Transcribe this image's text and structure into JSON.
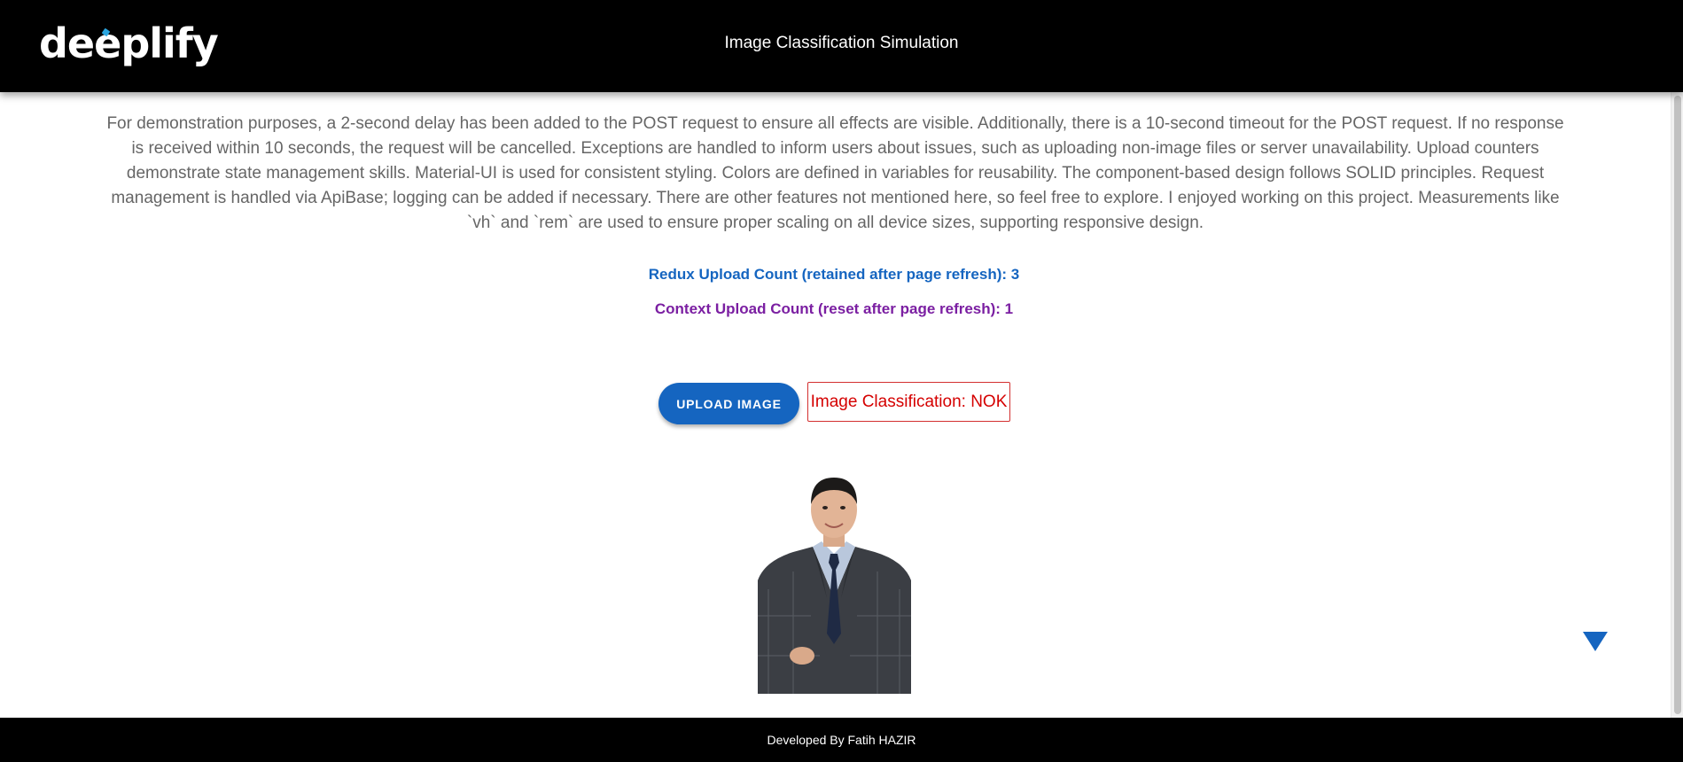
{
  "header": {
    "logo_text": "deeplify",
    "title": "Image Classification Simulation"
  },
  "main": {
    "description": "For demonstration purposes, a 2-second delay has been added to the POST request to ensure all effects are visible. Additionally, there is a 10-second timeout for the POST request. If no response is received within 10 seconds, the request will be cancelled. Exceptions are handled to inform users about issues, such as uploading non-image files or server unavailability. Upload counters demonstrate state management skills. Material-UI is used for consistent styling. Colors are defined in variables for reusability. The component-based design follows SOLID principles. Request management is handled via ApiBase; logging can be added if necessary. There are other features not mentioned here, so feel free to explore. I enjoyed working on this project. Measurements like `vh` and `rem` are used to ensure proper scaling on all device sizes, supporting responsive design.",
    "redux_count_text": "Redux Upload Count (retained after page refresh): 3",
    "context_count_text": "Context Upload Count (reset after page refresh): 1",
    "upload_button_label": "UPLOAD IMAGE",
    "classification_result": "Image Classification: NOK",
    "photo_icon": "uploaded-portrait-image",
    "scroll_icon": "triangle-down-icon"
  },
  "footer": {
    "text": "Developed By Fatih HAZIR"
  },
  "colors": {
    "header_bg": "#000000",
    "primary": "#1565c0",
    "secondary": "#7b1fa2",
    "error": "#d50000",
    "body_text": "#666666"
  }
}
